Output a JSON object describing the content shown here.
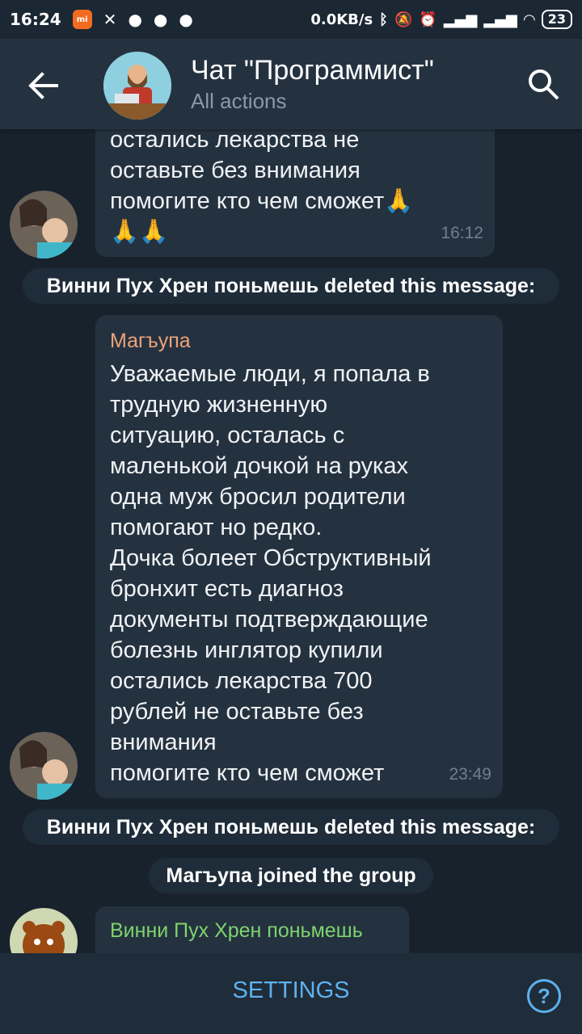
{
  "status_bar": {
    "time": "16:24",
    "network_speed": "0.0KB/s",
    "battery": "23",
    "icons": [
      "mi-icon",
      "tools-icon",
      "location-pin-icon",
      "location-pin-icon",
      "location-pin-icon",
      "bluetooth-icon",
      "mute-icon",
      "alarm-icon",
      "signal-icon",
      "signal-icon",
      "wifi-icon",
      "battery-icon"
    ]
  },
  "header": {
    "title": "Чат \"Программист\"",
    "subtitle": "All actions"
  },
  "messages": [
    {
      "text_lines": [
        "остались лекарства    не",
        "оставьте без внимания",
        " помогите кто чем сможет🙏",
        "🙏🙏"
      ],
      "time": "16:12"
    },
    {
      "sender": "Магъупа",
      "sender_color": "#f0a27a",
      "text_lines": [
        "Уважаемые люди,  я попала в",
        "трудную жизненную",
        "ситуацию, осталась с",
        "маленькой дочкой на руках",
        "одна муж бросил родители",
        "помогают но редко.",
        "Дочка болеет Обструктивный",
        "бронхит есть диагноз",
        "документы подтверждающие",
        "болезнь инглятор купили",
        "остались лекарства 700",
        "рублей   не оставьте без",
        "внимания",
        " помогите кто чем сможет"
      ],
      "time": "23:49"
    },
    {
      "sender": "Винни Пух Хрен поньмешь",
      "sender_color": "#7fd36d"
    }
  ],
  "service_messages": [
    "Винни Пух Хрен поньмешь deleted this message:",
    "Винни Пух Хрен поньмешь deleted this message:",
    "Магъупа joined the group"
  ],
  "bottom_bar": {
    "settings_label": "SETTINGS",
    "help_label": "?"
  },
  "colors": {
    "accent": "#5eb1ee",
    "background": "#18222d",
    "header": "#243240",
    "bubble": "#243240"
  }
}
